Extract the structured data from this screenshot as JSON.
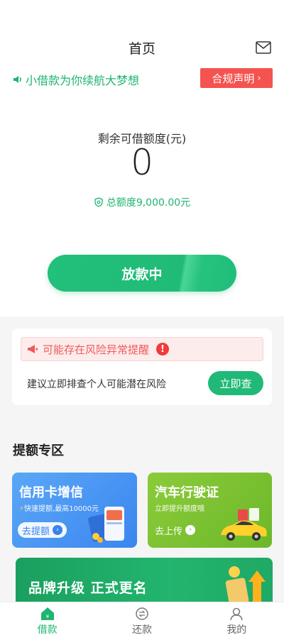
{
  "header": {
    "title": "首页"
  },
  "slogan": {
    "text": "小借款为你续航大梦想",
    "compliance": "合规声明"
  },
  "quota": {
    "label": "剩余可借额度(元)",
    "value": "0",
    "total": "总额度9,000.00元"
  },
  "loan_button": {
    "label": "放款中"
  },
  "risk": {
    "alert": "可能存在风险异常提醒",
    "advice": "建议立即排查个人可能潜在风险",
    "check_label": "立即查"
  },
  "section": {
    "title": "提额专区"
  },
  "promos": [
    {
      "title": "信用卡增信",
      "subtitle": "快速提额,最高10000元",
      "button": "去提额"
    },
    {
      "title": "汽车行驶证",
      "subtitle": "立即提升额度哦",
      "button": "去上传"
    }
  ],
  "banner": {
    "title": "品牌升级  正式更名"
  },
  "tabs": [
    {
      "label": "借款",
      "icon": "home-icon",
      "active": true
    },
    {
      "label": "还款",
      "icon": "repay-icon",
      "active": false
    },
    {
      "label": "我的",
      "icon": "user-icon",
      "active": false
    }
  ],
  "colors": {
    "accent": "#1fb472",
    "warning": "#f4534f",
    "alert_bg": "#fdecec"
  }
}
